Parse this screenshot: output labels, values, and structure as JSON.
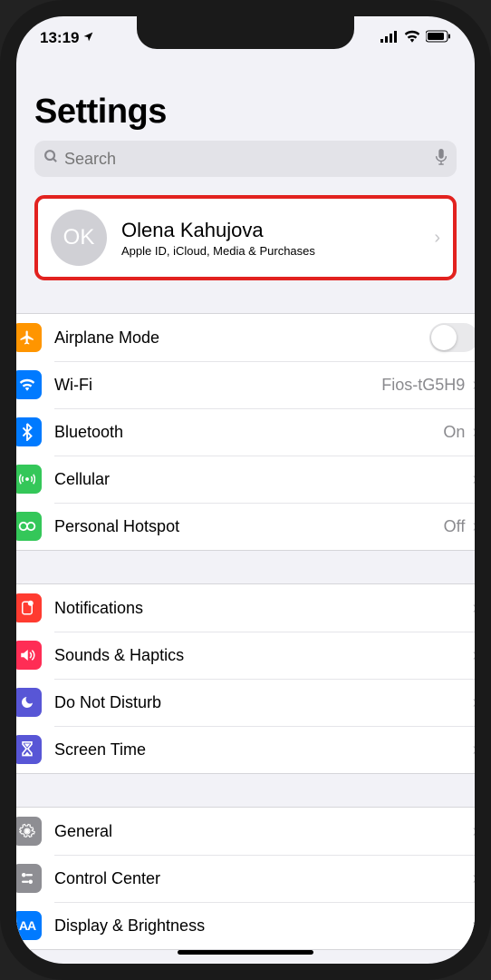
{
  "status": {
    "time": "13:19",
    "signal": "signal",
    "wifi": "wifi",
    "battery": "battery"
  },
  "title": "Settings",
  "search": {
    "placeholder": "Search"
  },
  "profile": {
    "initials": "OK",
    "name": "Olena Kahujova",
    "sub": "Apple ID, iCloud, Media & Purchases"
  },
  "groups": [
    {
      "rows": [
        {
          "icon": "airplane",
          "color": "#ff9500",
          "label": "Airplane Mode",
          "control": "toggle",
          "value_on": false
        },
        {
          "icon": "wifi",
          "color": "#007aff",
          "label": "Wi-Fi",
          "value": "Fios-tG5H9",
          "chevron": true
        },
        {
          "icon": "bluetooth",
          "color": "#007aff",
          "label": "Bluetooth",
          "value": "On",
          "chevron": true
        },
        {
          "icon": "cellular",
          "color": "#34c759",
          "label": "Cellular",
          "chevron": true
        },
        {
          "icon": "hotspot",
          "color": "#34c759",
          "label": "Personal Hotspot",
          "value": "Off",
          "chevron": true
        }
      ]
    },
    {
      "rows": [
        {
          "icon": "notifications",
          "color": "#ff3b30",
          "label": "Notifications",
          "chevron": true
        },
        {
          "icon": "sounds",
          "color": "#ff2d55",
          "label": "Sounds & Haptics",
          "chevron": true
        },
        {
          "icon": "dnd",
          "color": "#5856d6",
          "label": "Do Not Disturb",
          "chevron": true
        },
        {
          "icon": "screentime",
          "color": "#5856d6",
          "label": "Screen Time",
          "chevron": true
        }
      ]
    },
    {
      "rows": [
        {
          "icon": "general",
          "color": "#8e8e93",
          "label": "General",
          "chevron": true
        },
        {
          "icon": "control-center",
          "color": "#8e8e93",
          "label": "Control Center",
          "chevron": true
        },
        {
          "icon": "display",
          "color": "#007aff",
          "label": "Display & Brightness",
          "chevron": true
        }
      ]
    }
  ]
}
